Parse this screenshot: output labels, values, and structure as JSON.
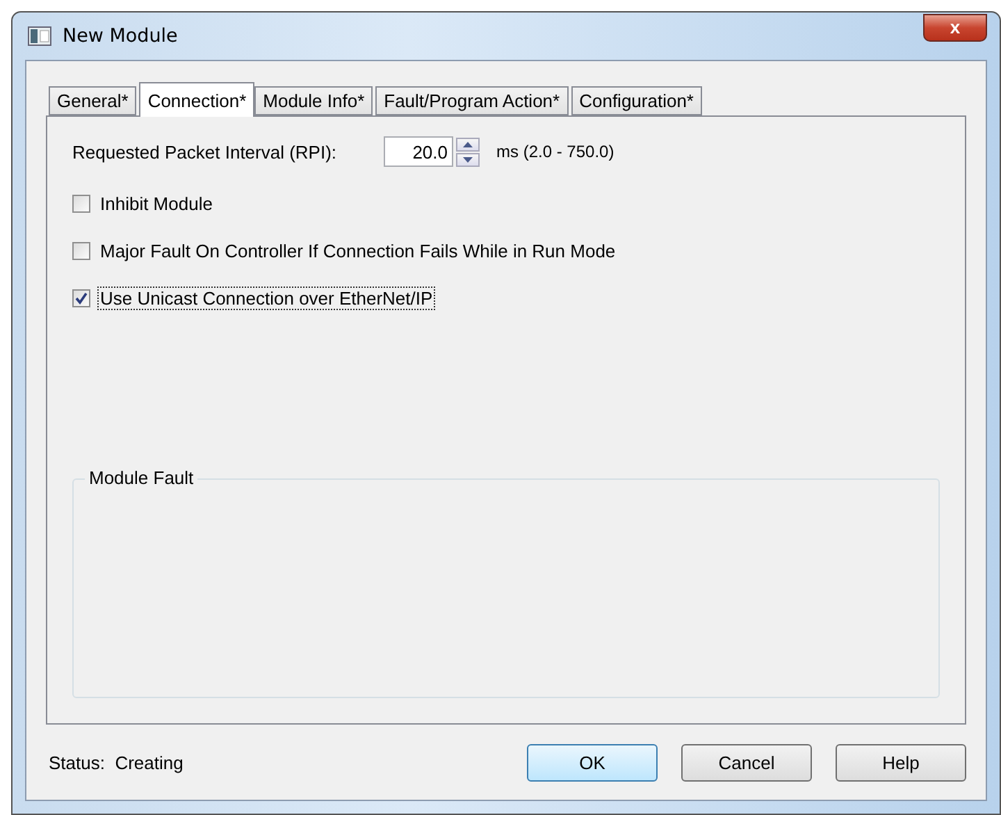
{
  "window": {
    "title": "New Module",
    "close": "x"
  },
  "tabs": [
    {
      "label": "General*",
      "selected": false
    },
    {
      "label": "Connection*",
      "selected": true
    },
    {
      "label": "Module Info*",
      "selected": false
    },
    {
      "label": "Fault/Program Action*",
      "selected": false
    },
    {
      "label": "Configuration*",
      "selected": false
    }
  ],
  "rpi": {
    "label": "Requested Packet Interval (RPI):",
    "value": "20.0",
    "range": "ms (2.0 - 750.0)"
  },
  "options": [
    {
      "label": "Inhibit Module",
      "checked": false,
      "focused": false
    },
    {
      "label": "Major Fault On Controller If Connection Fails While in Run Mode",
      "checked": false,
      "focused": false
    },
    {
      "label": "Use Unicast Connection over EtherNet/IP",
      "checked": true,
      "focused": true
    }
  ],
  "module_fault": {
    "title": "Module Fault"
  },
  "status": {
    "label": "Status:",
    "value": "Creating"
  },
  "buttons": [
    {
      "label": "OK",
      "default": true
    },
    {
      "label": "Cancel",
      "default": false
    },
    {
      "label": "Help",
      "default": false
    }
  ]
}
